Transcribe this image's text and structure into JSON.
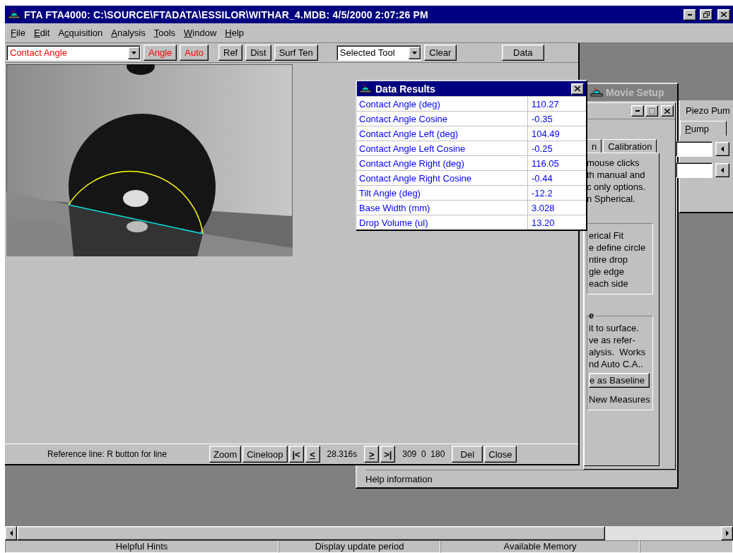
{
  "window": {
    "title": "FTA FTA4000: C:\\SOURCE\\FTADATA\\ESSILOR\\WITHAR_4.MDB: 4/5/2000 2:07:26 PM"
  },
  "menu": [
    {
      "key": "F",
      "post": "ile"
    },
    {
      "key": "E",
      "post": "dit"
    },
    {
      "pre": "A",
      "key": "c",
      "post": "quisition"
    },
    {
      "key": "A",
      "post": "nalysis"
    },
    {
      "key": "T",
      "post": "ools"
    },
    {
      "key": "W",
      "post": "indow"
    },
    {
      "key": "H",
      "post": "elp"
    }
  ],
  "image_window": {
    "toolbar": {
      "mode_select": {
        "value": "Contact Angle",
        "active": true
      },
      "buttons": [
        {
          "label": "Angle",
          "active": true
        },
        {
          "label": "Auto",
          "active": true
        },
        {
          "label": "Ref",
          "active": false
        },
        {
          "label": "Dist",
          "active": false
        },
        {
          "label": "Surf Ten",
          "active": false
        }
      ],
      "tool_select": {
        "value": "Selected Tool"
      },
      "tool_buttons": [
        {
          "label": "Clear"
        },
        {
          "label": "Data"
        }
      ]
    },
    "footer": {
      "hint": "Reference line: R button for line",
      "controls": [
        {
          "kind": "button",
          "label": "Zoom"
        },
        {
          "kind": "button",
          "label": "Cineloop"
        },
        {
          "kind": "step",
          "label": "|<",
          "underlined": false
        },
        {
          "kind": "step",
          "label": "<",
          "underlined": true
        },
        {
          "kind": "readout",
          "label": "28.316s"
        },
        {
          "kind": "step",
          "label": ">",
          "underlined": true
        },
        {
          "kind": "step",
          "label": ">|",
          "underlined": false
        },
        {
          "kind": "readout",
          "label": "309  0  180"
        },
        {
          "kind": "button",
          "label": "Del"
        },
        {
          "kind": "button",
          "label": "Close"
        }
      ]
    }
  },
  "data_results": {
    "title": "Data Results",
    "rows": [
      {
        "label": "Contact Angle (deg)",
        "value": "110.27"
      },
      {
        "label": "Contact Angle Cosine",
        "value": "-0.35"
      },
      {
        "label": "Contact Angle Left (deg)",
        "value": "104.49"
      },
      {
        "label": "Contact Angle Left Cosine",
        "value": "-0.25"
      },
      {
        "label": "Contact Angle Right (deg)",
        "value": "116.05"
      },
      {
        "label": "Contact Angle Right Cosine",
        "value": "-0.44"
      },
      {
        "label": "Tilt Angle (deg)",
        "value": "-12.2"
      },
      {
        "label": "Base Width (mm)",
        "value": "3.028"
      },
      {
        "label": "Drop Volume (ul)",
        "value": "13.20"
      }
    ]
  },
  "movie_setup": {
    "title": "Movie Setup",
    "tabs": [
      {
        "label": "n",
        "selected": false
      },
      {
        "label": "Calibration",
        "selected": false
      }
    ],
    "intro_lines": [
      "mouse clicks",
      "th manual and",
      "c only options.",
      "n Spherical."
    ],
    "groups": [
      {
        "lines": [
          "erical Fit",
          "e define circle",
          "ntire drop",
          "gle edge",
          "each side"
        ]
      },
      {
        "heading": "e",
        "lines": [
          "it to surface.",
          "ve as refer-",
          "alysis.  Works",
          "nd Auto C.A.."
        ],
        "button": "e as Baseline",
        "footer": "New Measures"
      }
    ],
    "help": "Help information"
  },
  "piezo_pump": {
    "title": "Piezo Pum",
    "tabs": [
      {
        "key": "P",
        "post": "ump",
        "selected": true
      }
    ]
  },
  "status_bar": [
    "Helpful Hints",
    "Display update period",
    "Available Memory"
  ]
}
